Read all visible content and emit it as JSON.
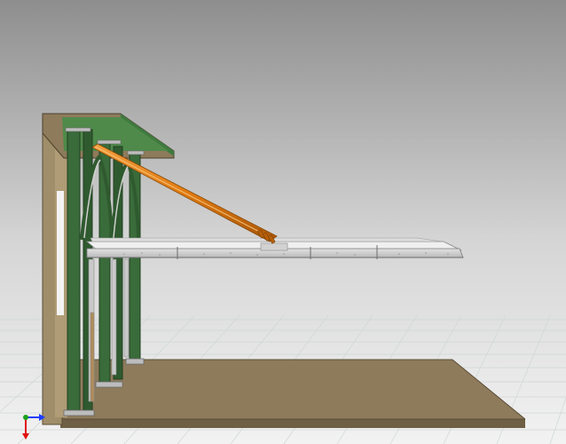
{
  "viewport": {
    "background_top": "#8f8f8f",
    "background_bottom": "#f0f0f0",
    "grid_color": "#cfd6d6"
  },
  "model": {
    "elements": [
      "back-wall",
      "roof-slab",
      "ground-slab",
      "steel-columns",
      "diagonal-bracing",
      "cantilever-beam-deck",
      "orange-stay-strut"
    ],
    "colors": {
      "wall": "#a08e6a",
      "slab": "#8e7b5b",
      "steel": "#3a6b3a",
      "beam": "#c8c8c8",
      "strut": "#e07a10"
    }
  },
  "axis_triad": {
    "x_color": "#1a3cff",
    "y_color": "#1aa01a",
    "z_color": "#e01010"
  }
}
